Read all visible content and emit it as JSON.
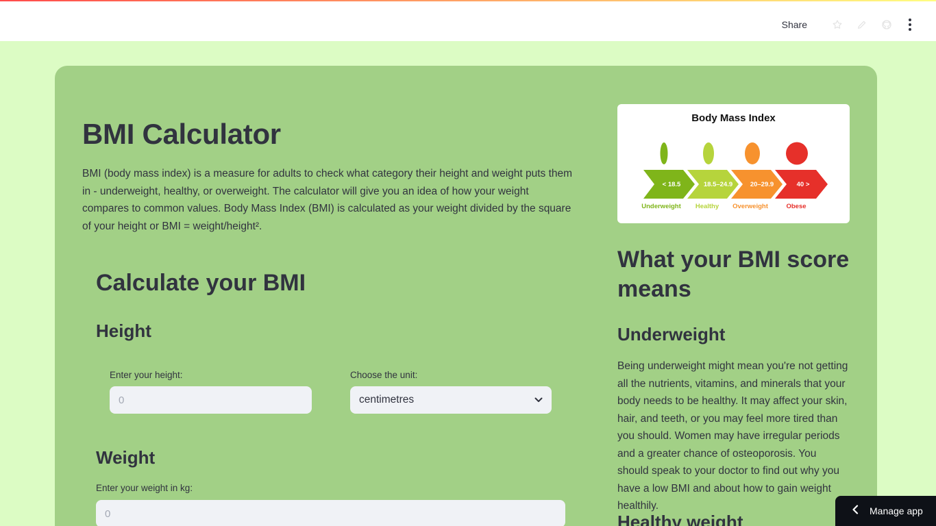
{
  "toolbar": {
    "share_label": "Share",
    "icons": [
      "star-icon",
      "edit-icon",
      "github-icon",
      "more-vertical-icon"
    ]
  },
  "colors": {
    "page_background": "#dcfcc4",
    "card_background": "#a2d086",
    "text": "#31333f",
    "input_background": "#f0f2f6",
    "underweight": "#7fb51a",
    "healthy": "#b6d43c",
    "overweight": "#f7922e",
    "obese": "#e6302a"
  },
  "main": {
    "title": "BMI Calculator",
    "intro": "BMI (body mass index) is a measure for adults to check what category their height and weight puts them in - underweight, healthy, or overweight. The calculator will give you an idea of how your weight compares to common values. Body Mass Index (BMI) is calculated as your weight divided by the square of your height or BMI = weight/height².",
    "calc_title": "Calculate your BMI",
    "height": {
      "title": "Height",
      "input_label": "Enter your height:",
      "input_placeholder": "0",
      "unit_label": "Choose the unit:",
      "unit_value": "centimetres"
    },
    "weight": {
      "title": "Weight",
      "input_label": "Enter your weight in kg:",
      "input_placeholder": "0"
    }
  },
  "sidebar_image": {
    "title": "Body Mass Index",
    "categories": [
      {
        "range": "< 18.5",
        "label": "Underweight"
      },
      {
        "range": "18.5–24.9",
        "label": "Healthy"
      },
      {
        "range": "20–29.9",
        "label": "Overweight"
      },
      {
        "range": "40 >",
        "label": "Obese"
      }
    ]
  },
  "right": {
    "means_title": "What your BMI score means",
    "underweight_title": "Underweight",
    "underweight_text": "Being underweight might mean you're not getting all the nutrients, vitamins, and minerals that your body needs to be healthy. It may affect your skin, hair, and teeth, or you may feel more tired than you should. Women may have irregular periods and a greater chance of osteoporosis. You should speak to your doctor to find out why you have a low BMI and about how to gain weight healthily.",
    "healthy_title": "Healthy weight"
  },
  "manage_app_label": "Manage app"
}
